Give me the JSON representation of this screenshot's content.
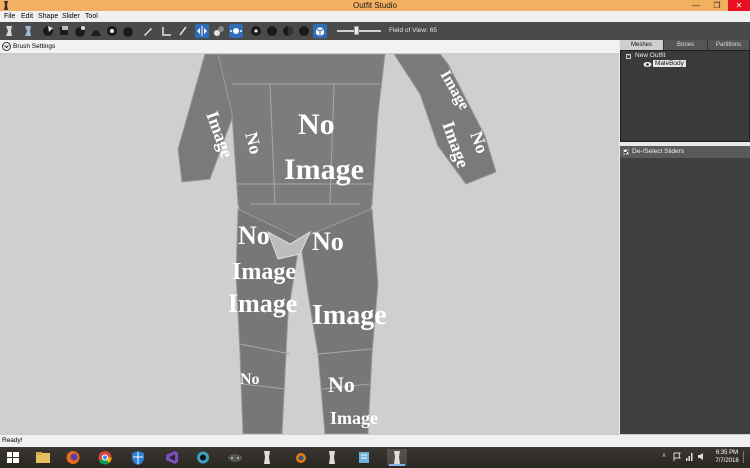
{
  "window": {
    "title": "Outfit Studio"
  },
  "menu": [
    "File",
    "Edit",
    "Shape",
    "Slider",
    "Tool"
  ],
  "toolbar": {
    "fov_label": "Field of View: 65"
  },
  "brush_settings": {
    "label": "Brush Settings"
  },
  "viewport": {
    "texture_word_1": "No",
    "texture_word_2": "Image"
  },
  "right_panel": {
    "tabs": [
      "Meshes",
      "Bones",
      "Partitions"
    ],
    "active_tab": "Meshes",
    "tree": {
      "root": "New Outfit",
      "child": "MaleBody"
    },
    "sliders_toggle": "De-/Select Sliders"
  },
  "status": "Ready!",
  "taskbar": {
    "time": "6:35 PM",
    "date": "7/7/2018"
  },
  "colors": {
    "titlebar": "#f2b161",
    "toolbar": "#4a4a4a",
    "active_tool": "#2f6db8",
    "viewport": "#cfcfcf",
    "close": "#e81123"
  }
}
